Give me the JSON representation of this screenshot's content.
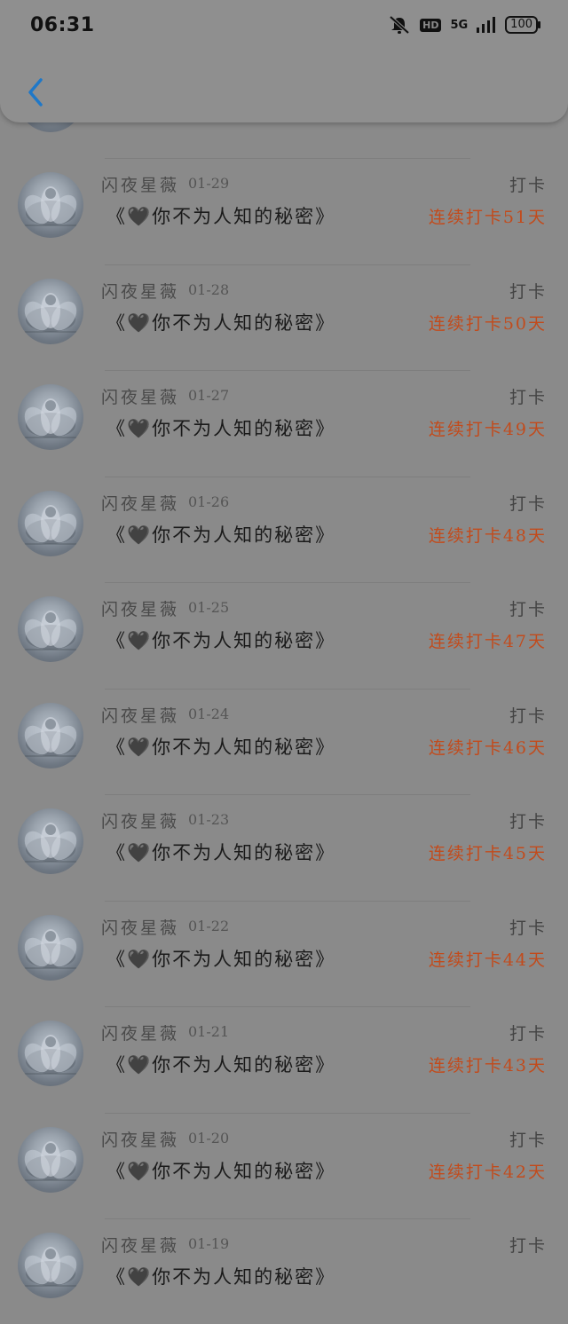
{
  "status_bar": {
    "time": "06:31",
    "network": "5G",
    "hd": "HD",
    "battery": "100"
  },
  "nav": {
    "back_icon": "chevron-left-icon",
    "accent": "#1f78c8"
  },
  "entries": [
    {
      "name": "闪夜星薇",
      "date": "01-29",
      "title": "《🖤你不为人知的秘密》",
      "action": "打卡",
      "streak": "连续打卡51天"
    },
    {
      "name": "闪夜星薇",
      "date": "01-28",
      "title": "《🖤你不为人知的秘密》",
      "action": "打卡",
      "streak": "连续打卡50天"
    },
    {
      "name": "闪夜星薇",
      "date": "01-27",
      "title": "《🖤你不为人知的秘密》",
      "action": "打卡",
      "streak": "连续打卡49天"
    },
    {
      "name": "闪夜星薇",
      "date": "01-26",
      "title": "《🖤你不为人知的秘密》",
      "action": "打卡",
      "streak": "连续打卡48天"
    },
    {
      "name": "闪夜星薇",
      "date": "01-25",
      "title": "《🖤你不为人知的秘密》",
      "action": "打卡",
      "streak": "连续打卡47天"
    },
    {
      "name": "闪夜星薇",
      "date": "01-24",
      "title": "《🖤你不为人知的秘密》",
      "action": "打卡",
      "streak": "连续打卡46天"
    },
    {
      "name": "闪夜星薇",
      "date": "01-23",
      "title": "《🖤你不为人知的秘密》",
      "action": "打卡",
      "streak": "连续打卡45天"
    },
    {
      "name": "闪夜星薇",
      "date": "01-22",
      "title": "《🖤你不为人知的秘密》",
      "action": "打卡",
      "streak": "连续打卡44天"
    },
    {
      "name": "闪夜星薇",
      "date": "01-21",
      "title": "《🖤你不为人知的秘密》",
      "action": "打卡",
      "streak": "连续打卡43天"
    },
    {
      "name": "闪夜星薇",
      "date": "01-20",
      "title": "《🖤你不为人知的秘密》",
      "action": "打卡",
      "streak": "连续打卡42天"
    },
    {
      "name": "闪夜星薇",
      "date": "01-19",
      "title": "《🖤你不为人知的秘密》",
      "action": "打卡",
      "streak": ""
    }
  ]
}
